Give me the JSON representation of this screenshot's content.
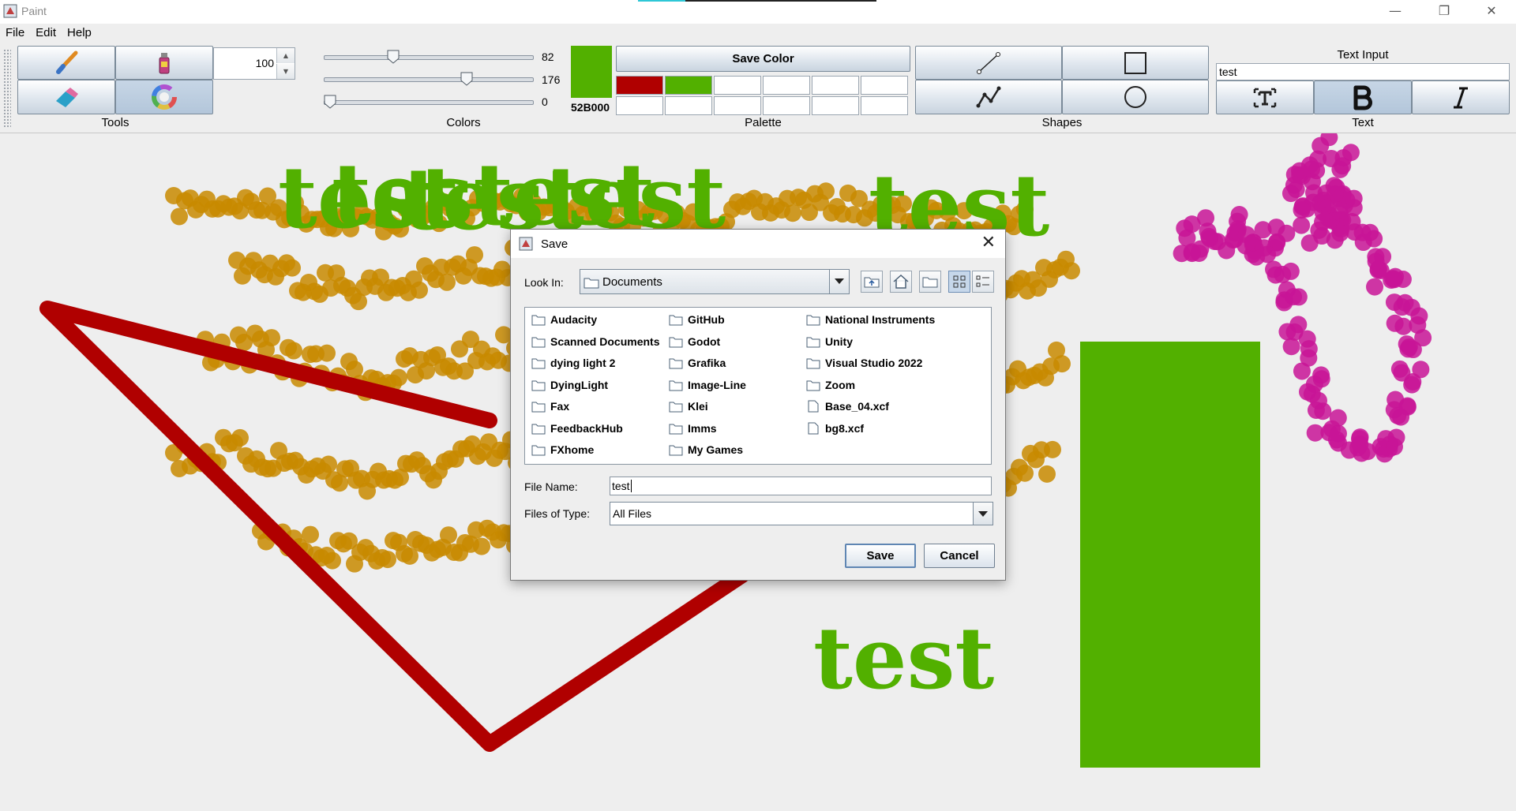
{
  "window": {
    "title": "Paint",
    "minimize_icon": "minimize-icon",
    "maximize_icon": "restore-icon",
    "close_icon": "close-icon"
  },
  "menu": [
    "File",
    "Edit",
    "Help"
  ],
  "toolbar": {
    "tools": {
      "label": "Tools",
      "items": [
        "brush-icon",
        "spray-can-icon",
        "eraser-icon",
        "color-wheel-icon"
      ]
    },
    "brush_size": "100",
    "colors": {
      "label": "Colors",
      "red": 82,
      "green": 176,
      "blue": 0,
      "red_label": "82",
      "green_label": "176",
      "blue_label": "0",
      "current_hex": "52B000",
      "current_color": "#52b000"
    },
    "palette": {
      "label": "Palette",
      "save_label": "Save Color",
      "cells": [
        "#b00000",
        "#52b000",
        "#ffffff",
        "#ffffff",
        "#ffffff",
        "#ffffff",
        "#ffffff",
        "#ffffff",
        "#ffffff",
        "#ffffff",
        "#ffffff",
        "#ffffff"
      ]
    },
    "shapes": {
      "label": "Shapes",
      "items": [
        "line-icon",
        "rectangle-icon",
        "polyline-icon",
        "ellipse-icon"
      ]
    },
    "text": {
      "label": "Text",
      "input_label": "Text Input",
      "input_value": "test",
      "items": [
        "text-tool-icon",
        "bold-icon",
        "italic-icon"
      ]
    }
  },
  "canvas": {
    "texts": [
      "test",
      "test",
      "test",
      "test",
      "test",
      "test",
      "test"
    ],
    "colors": {
      "dots": "#c88a00",
      "magenta": "#c81496",
      "red": "#b00000",
      "green": "#52b000"
    }
  },
  "dialog": {
    "title": "Save",
    "look_in_label": "Look In:",
    "look_in_value": "Documents",
    "toolbar_icons": [
      "up-folder-icon",
      "home-icon",
      "new-folder-icon",
      "list-view-icon",
      "details-view-icon"
    ],
    "columns": [
      [
        {
          "name": "Audacity",
          "type": "folder"
        },
        {
          "name": "Scanned Documents",
          "type": "folder"
        },
        {
          "name": "dying light 2",
          "type": "folder"
        },
        {
          "name": "DyingLight",
          "type": "folder"
        },
        {
          "name": "Fax",
          "type": "folder"
        },
        {
          "name": "FeedbackHub",
          "type": "folder"
        },
        {
          "name": "FXhome",
          "type": "folder"
        }
      ],
      [
        {
          "name": "GitHub",
          "type": "folder"
        },
        {
          "name": "Godot",
          "type": "folder"
        },
        {
          "name": "Grafika",
          "type": "folder"
        },
        {
          "name": "Image-Line",
          "type": "folder"
        },
        {
          "name": "Klei",
          "type": "folder"
        },
        {
          "name": "Imms",
          "type": "folder"
        },
        {
          "name": "My Games",
          "type": "folder"
        }
      ],
      [
        {
          "name": "National Instruments",
          "type": "folder"
        },
        {
          "name": "Unity",
          "type": "folder"
        },
        {
          "name": "Visual Studio 2022",
          "type": "folder"
        },
        {
          "name": "Zoom",
          "type": "folder"
        },
        {
          "name": "Base_04.xcf",
          "type": "file"
        },
        {
          "name": "bg8.xcf",
          "type": "file"
        }
      ]
    ],
    "file_name_label": "File Name:",
    "file_name_value": "test",
    "file_type_label": "Files of Type:",
    "file_type_value": "All Files",
    "save_label": "Save",
    "cancel_label": "Cancel"
  }
}
